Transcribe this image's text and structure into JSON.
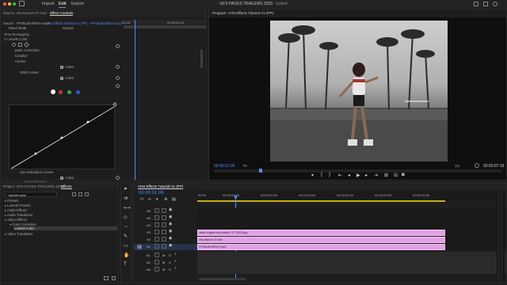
{
  "window": {
    "title": "GFX PACKS TRAILERS 2023",
    "edited": "- Edited",
    "menus": [
      "Import",
      "Edit",
      "Export"
    ]
  },
  "source_panel": {
    "tabs": [
      "Source: vhs-texture-07.mov",
      "Effect Controls"
    ],
    "source_line": "Source · FPS6o3b7M0GH.mp4",
    "sequence_line": "VHS Effects Tutorial V1 (PP) · FPS6o3b7M0GH.mp4",
    "blend_mode_label": "Blend Mode",
    "blend_mode_value": "Normal",
    "time_remapping": "Time Remapping",
    "effect_name": "Lumetri Color",
    "sections": [
      "Basic Correction",
      "Creative",
      "Curves"
    ],
    "active_label": "Active",
    "rgb_curves": "RGB Curves",
    "hue_sat_label": "Hue Saturation Curves",
    "hue_sat_sub": "Hue vs Saturation",
    "timecode_ruler": [
      "00:00",
      "00:00:04:13"
    ],
    "current_time": "00:00:01:06"
  },
  "program_monitor": {
    "title": "Program: VHS Effects Tutorial V1 (PP)",
    "timecode": "00:00:01:06",
    "fit": "Fit",
    "quality": "1/4",
    "duration": "00:00:07:16"
  },
  "project_panel": {
    "tabs": [
      "Project: GFX PACKS TRAILERS 2023",
      "Effects"
    ],
    "search_value": "lumetri color",
    "tree": [
      "Presets",
      "Lumetri Presets",
      "Audio Effects",
      "Audio Transitions",
      "Video Effects",
      "Color Correction",
      "Lumetri Color",
      "Video Transitions"
    ]
  },
  "timeline": {
    "tab": "VHS Effects Tutorial V1 (PP)",
    "timecode": "00:00:01:06",
    "ruler": [
      "00:00",
      "00:00:01:00",
      "00:00:02:00",
      "00:00:03:00",
      "00:00:04:00",
      "00:00:05:00",
      "00:00:06:00"
    ],
    "video_tracks": [
      "V6",
      "V5",
      "V4",
      "V3",
      "V2",
      "V1"
    ],
    "audio_tracks": [
      "A1",
      "A2",
      "A3"
    ],
    "clips": [
      "clean-organic-info-matte-2 17 2022.png",
      "vhs-texture-07.mov",
      "FPS6o3b7M0GH.mp4"
    ]
  },
  "colors": {
    "accent": "#4d8fff",
    "clip": "#e2a0e6",
    "playhead": "#4d8fff",
    "background": "#1d1d1d"
  }
}
